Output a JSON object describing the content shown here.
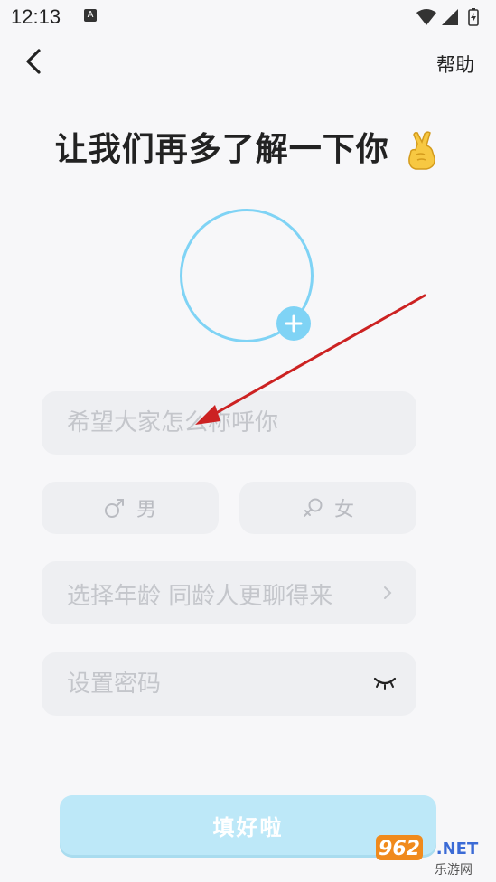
{
  "status_bar": {
    "time": "12:13",
    "notification_glyph": "A"
  },
  "topbar": {
    "help_label": "帮助"
  },
  "title": "让我们再多了解一下你",
  "form": {
    "nickname_placeholder": "希望大家怎么称呼你",
    "gender_male_label": "男",
    "gender_female_label": "女",
    "age_placeholder": "选择年龄 同龄人更聊得来",
    "password_placeholder": "设置密码"
  },
  "submit_label": "填好啦",
  "watermark": {
    "brand": "962.NET",
    "caption": "乐游网"
  },
  "colors": {
    "accent": "#7fd3f5",
    "field_bg": "#eeeff2",
    "submit_bg": "#bde8f8",
    "arrow": "#cc2222"
  },
  "icons": [
    "back-arrow-icon",
    "plus-icon",
    "male-icon",
    "female-icon",
    "chevron-right-icon",
    "eye-closed-icon",
    "fingers-crossed-emoji"
  ]
}
